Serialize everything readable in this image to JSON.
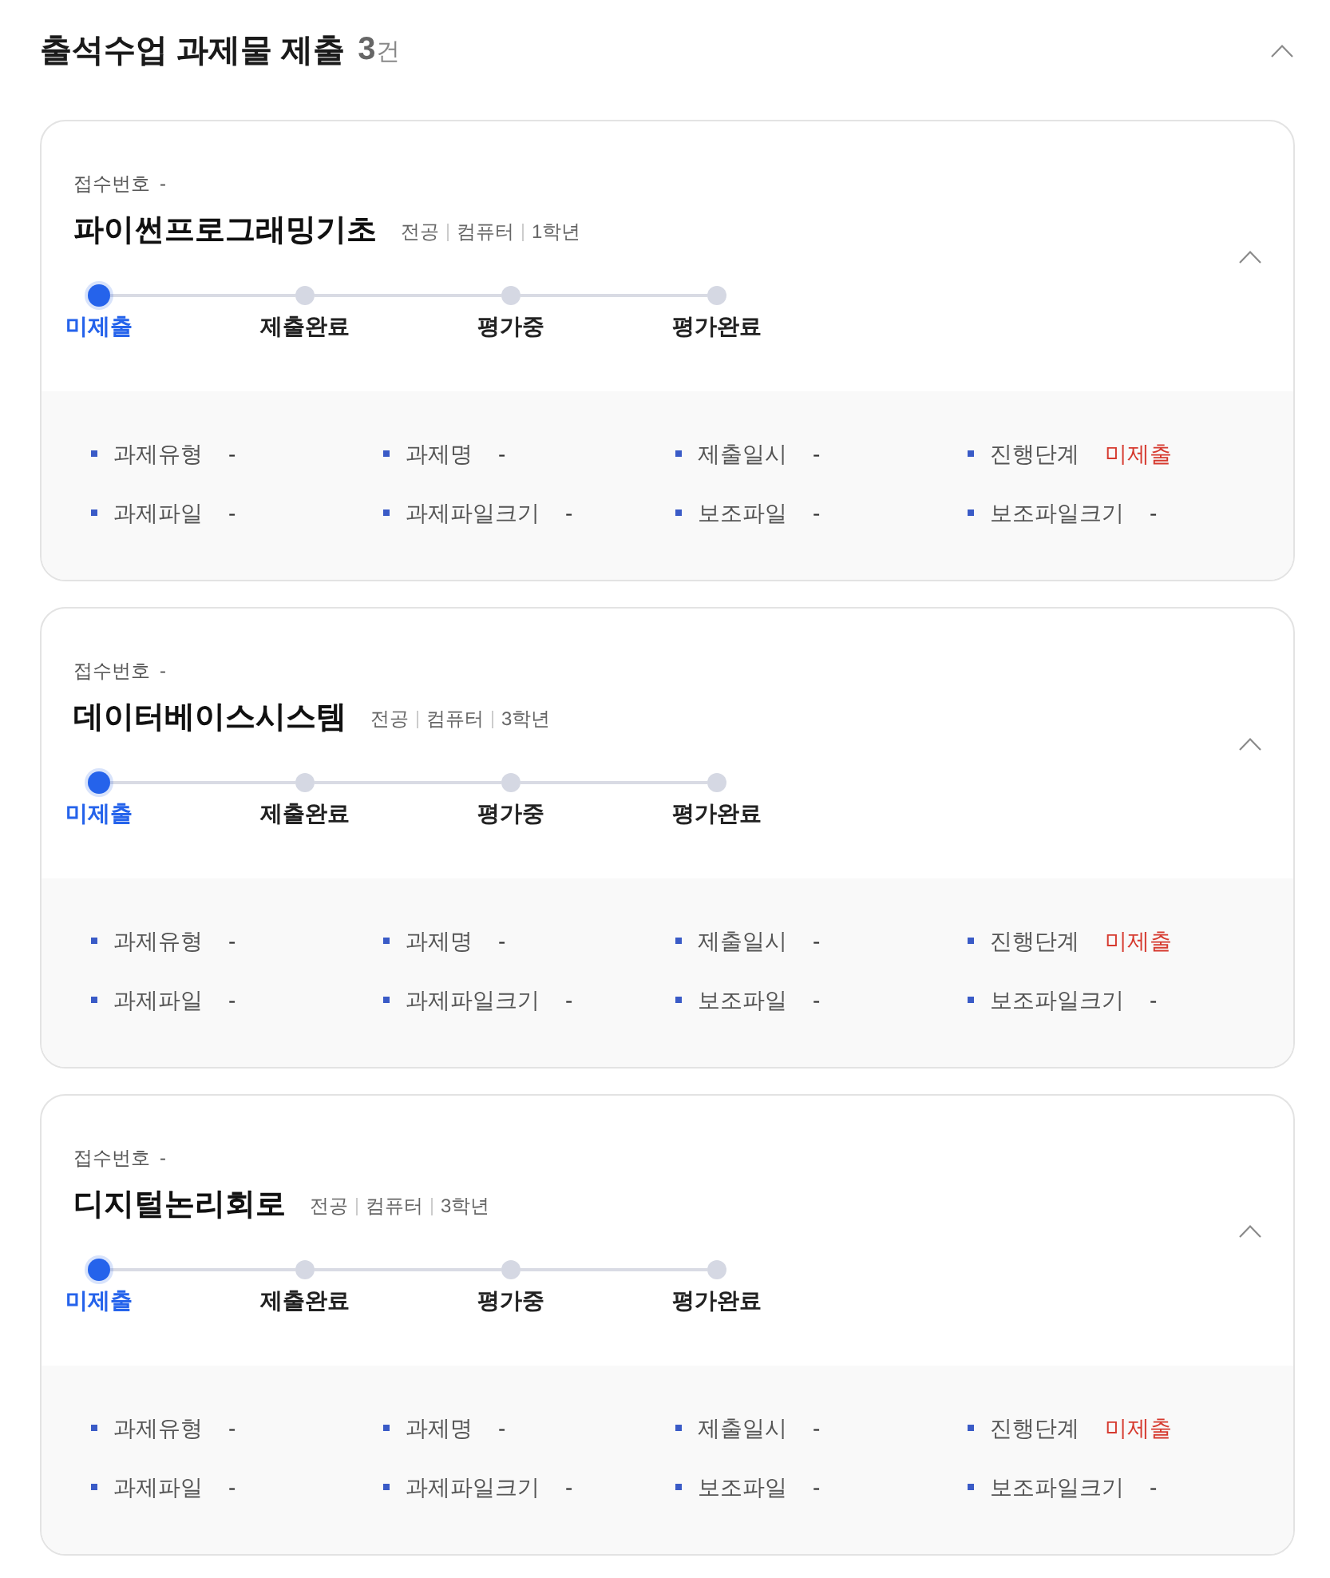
{
  "header": {
    "title": "출석수업 과제물 제출",
    "count": "3",
    "count_unit": "건",
    "expanded": true
  },
  "cards": [
    {
      "receipt_label": "접수번호",
      "receipt_value": "-",
      "title": "파이썬프로그래밍기초",
      "meta": [
        "전공",
        "컴퓨터",
        "1학년"
      ],
      "expanded": true,
      "steps": [
        {
          "label": "미제출",
          "selected": true
        },
        {
          "label": "제출완료",
          "selected": false
        },
        {
          "label": "평가중",
          "selected": false
        },
        {
          "label": "평가완료",
          "selected": false
        }
      ],
      "fields": [
        {
          "label": "과제유형",
          "value": "-",
          "kind": "plain"
        },
        {
          "label": "과제명",
          "value": "-",
          "kind": "plain"
        },
        {
          "label": "제출일시",
          "value": "-",
          "kind": "plain"
        },
        {
          "label": "진행단계",
          "value": "미제출",
          "kind": "status"
        },
        {
          "label": "과제파일",
          "value": "-",
          "kind": "plain"
        },
        {
          "label": "과제파일크기",
          "value": "-",
          "kind": "plain"
        },
        {
          "label": "보조파일",
          "value": "-",
          "kind": "plain"
        },
        {
          "label": "보조파일크기",
          "value": "-",
          "kind": "plain"
        }
      ]
    },
    {
      "receipt_label": "접수번호",
      "receipt_value": "-",
      "title": "데이터베이스시스템",
      "meta": [
        "전공",
        "컴퓨터",
        "3학년"
      ],
      "expanded": true,
      "steps": [
        {
          "label": "미제출",
          "selected": true
        },
        {
          "label": "제출완료",
          "selected": false
        },
        {
          "label": "평가중",
          "selected": false
        },
        {
          "label": "평가완료",
          "selected": false
        }
      ],
      "fields": [
        {
          "label": "과제유형",
          "value": "-",
          "kind": "plain"
        },
        {
          "label": "과제명",
          "value": "-",
          "kind": "plain"
        },
        {
          "label": "제출일시",
          "value": "-",
          "kind": "plain"
        },
        {
          "label": "진행단계",
          "value": "미제출",
          "kind": "status"
        },
        {
          "label": "과제파일",
          "value": "-",
          "kind": "plain"
        },
        {
          "label": "과제파일크기",
          "value": "-",
          "kind": "plain"
        },
        {
          "label": "보조파일",
          "value": "-",
          "kind": "plain"
        },
        {
          "label": "보조파일크기",
          "value": "-",
          "kind": "plain"
        }
      ]
    },
    {
      "receipt_label": "접수번호",
      "receipt_value": "-",
      "title": "디지털논리회로",
      "meta": [
        "전공",
        "컴퓨터",
        "3학년"
      ],
      "expanded": true,
      "steps": [
        {
          "label": "미제출",
          "selected": true
        },
        {
          "label": "제출완료",
          "selected": false
        },
        {
          "label": "평가중",
          "selected": false
        },
        {
          "label": "평가완료",
          "selected": false
        }
      ],
      "fields": [
        {
          "label": "과제유형",
          "value": "-",
          "kind": "plain"
        },
        {
          "label": "과제명",
          "value": "-",
          "kind": "plain"
        },
        {
          "label": "제출일시",
          "value": "-",
          "kind": "plain"
        },
        {
          "label": "진행단계",
          "value": "미제출",
          "kind": "status"
        },
        {
          "label": "과제파일",
          "value": "-",
          "kind": "plain"
        },
        {
          "label": "과제파일크기",
          "value": "-",
          "kind": "plain"
        },
        {
          "label": "보조파일",
          "value": "-",
          "kind": "plain"
        },
        {
          "label": "보조파일크기",
          "value": "-",
          "kind": "plain"
        }
      ]
    }
  ]
}
